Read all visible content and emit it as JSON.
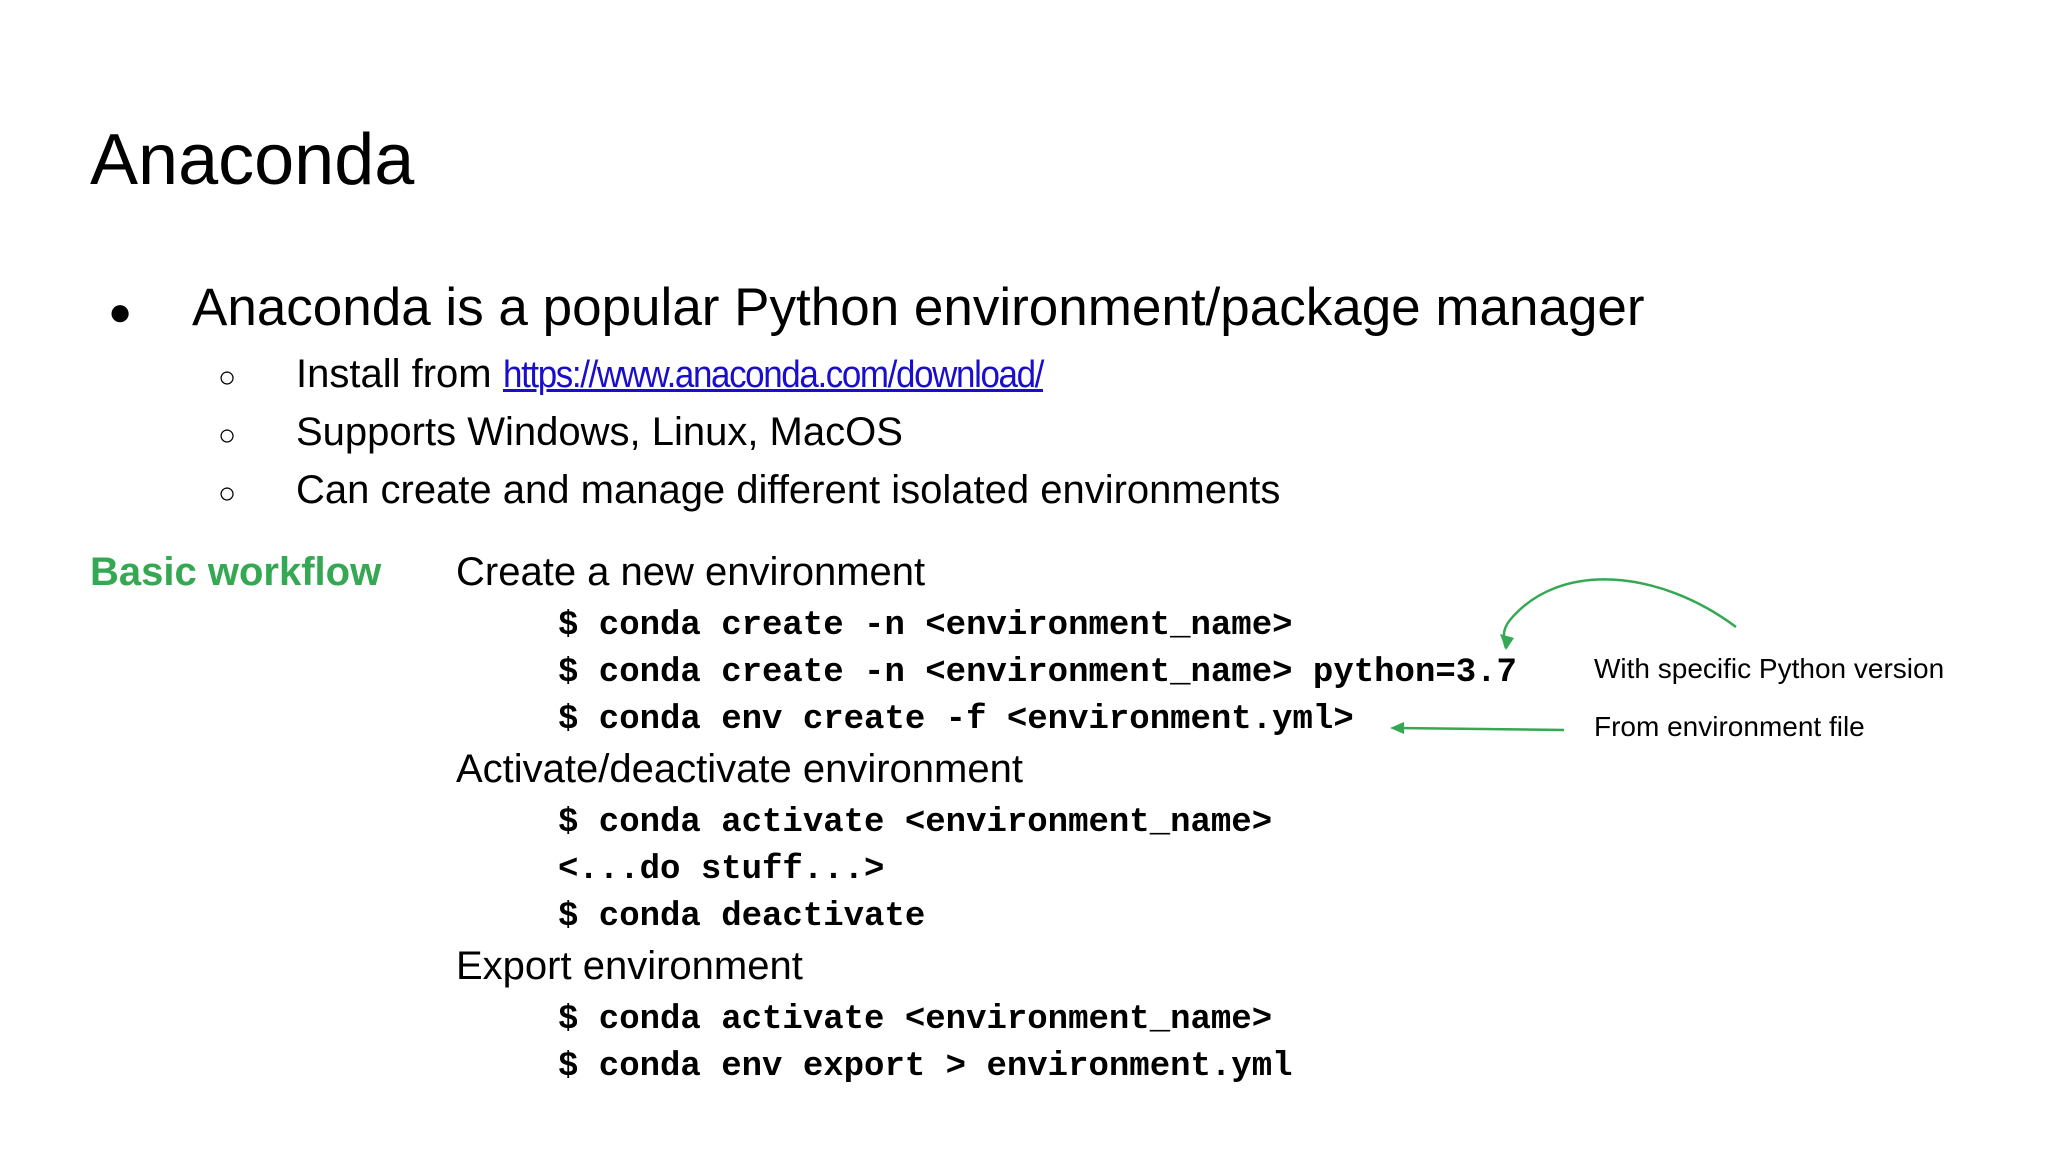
{
  "title": "Anaconda",
  "intro": {
    "bullet": "●",
    "text": "Anaconda is a popular Python environment/package manager"
  },
  "sub_bullets": [
    {
      "marker": "○",
      "prefix": "Install from ",
      "link": "https://www.anaconda.com/download/"
    },
    {
      "marker": "○",
      "text": "Supports Windows, Linux, MacOS"
    },
    {
      "marker": "○",
      "text": "Can create and manage different isolated environments"
    }
  ],
  "workflow": {
    "label": "Basic workflow",
    "label_color": "#34a853",
    "sections": [
      {
        "heading": "Create a new environment",
        "commands": [
          "$ conda create -n <environment_name>",
          "$ conda create -n <environment_name> python=3.7",
          "$ conda env create -f <environment.yml>"
        ]
      },
      {
        "heading": "Activate/deactivate environment",
        "commands": [
          "$ conda activate <environment_name>",
          "<...do stuff...>",
          "$ conda deactivate"
        ]
      },
      {
        "heading": "Export environment",
        "commands": [
          "$ conda activate <environment_name>",
          "$ conda env export > environment.yml"
        ]
      }
    ]
  },
  "annotations": {
    "python_version": "With specific Python version",
    "env_file": "From environment file",
    "arrow_color": "#34a853"
  }
}
